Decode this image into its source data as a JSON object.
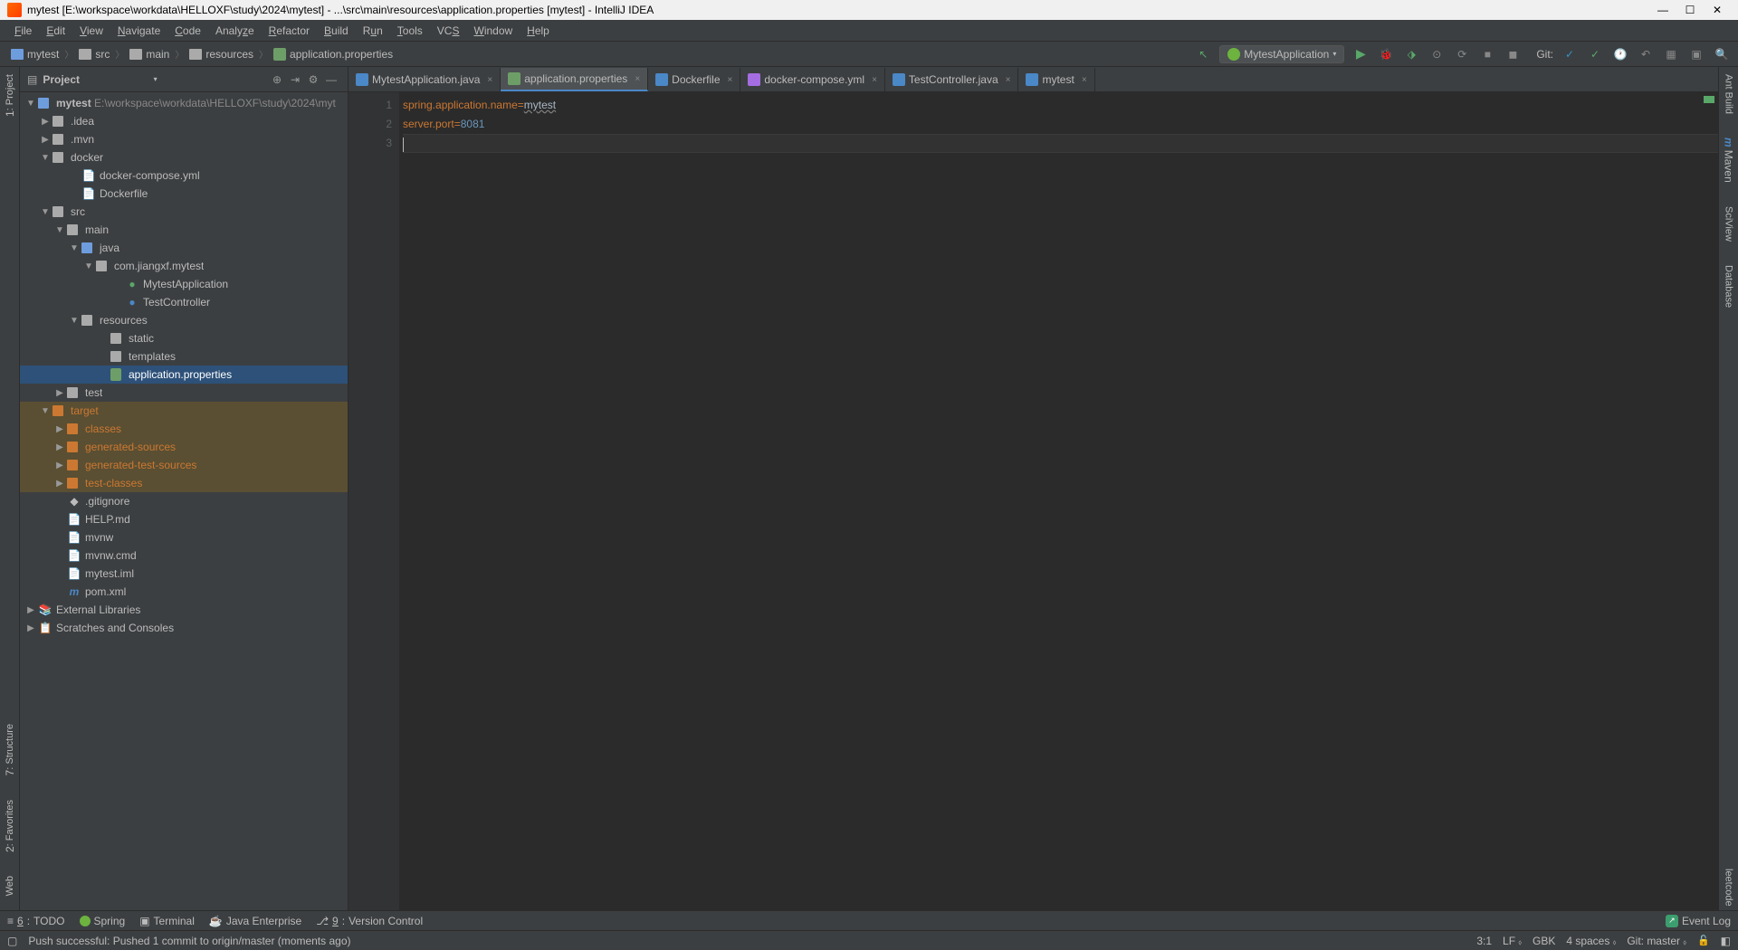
{
  "window": {
    "title": "mytest [E:\\workspace\\workdata\\HELLOXF\\study\\2024\\mytest] - ...\\src\\main\\resources\\application.properties [mytest] - IntelliJ IDEA"
  },
  "menu": [
    "File",
    "Edit",
    "View",
    "Navigate",
    "Code",
    "Analyze",
    "Refactor",
    "Build",
    "Run",
    "Tools",
    "VCS",
    "Window",
    "Help"
  ],
  "breadcrumbs": [
    "mytest",
    "src",
    "main",
    "resources",
    "application.properties"
  ],
  "runConfig": "MytestApplication",
  "gitLabel": "Git:",
  "leftGutter": [
    "1: Project"
  ],
  "leftGutterBottom": [
    "7: Structure",
    "2: Favorites",
    "Web"
  ],
  "rightGutter": [
    "Ant Build",
    "Maven",
    "SciView",
    "Database",
    "leetcode"
  ],
  "projectPanel": {
    "title": "Project"
  },
  "tree": {
    "root": {
      "name": "mytest",
      "path": "E:\\workspace\\workdata\\HELLOXF\\study\\2024\\myt"
    },
    "idea": ".idea",
    "mvn": ".mvn",
    "docker": "docker",
    "dockerCompose": "docker-compose.yml",
    "dockerfile": "Dockerfile",
    "src": "src",
    "main": "main",
    "java": "java",
    "pkg": "com.jiangxf.mytest",
    "mytestApp": "MytestApplication",
    "testCtrl": "TestController",
    "resources": "resources",
    "static": "static",
    "templates": "templates",
    "appProps": "application.properties",
    "test": "test",
    "target": "target",
    "classes": "classes",
    "genSrc": "generated-sources",
    "genTestSrc": "generated-test-sources",
    "testClasses": "test-classes",
    "gitignore": ".gitignore",
    "help": "HELP.md",
    "mvnw": "mvnw",
    "mvnwCmd": "mvnw.cmd",
    "iml": "mytest.iml",
    "pom": "pom.xml",
    "extLib": "External Libraries",
    "scratches": "Scratches and Consoles"
  },
  "editorTabs": [
    {
      "name": "MytestApplication.java",
      "type": "java",
      "active": false
    },
    {
      "name": "application.properties",
      "type": "prop",
      "active": true
    },
    {
      "name": "Dockerfile",
      "type": "docker",
      "active": false
    },
    {
      "name": "docker-compose.yml",
      "type": "yml",
      "active": false
    },
    {
      "name": "TestController.java",
      "type": "java",
      "active": false
    },
    {
      "name": "mytest",
      "type": "m",
      "active": false
    }
  ],
  "code": {
    "line1_key": "spring.application.name",
    "line1_op": "=",
    "line1_val": "mytest",
    "line2_key": "server.port",
    "line2_op": "=",
    "line2_val": "8081",
    "gutter": [
      "1",
      "2",
      "3"
    ]
  },
  "bottomTools": {
    "todo": "6: TODO",
    "spring": "Spring",
    "terminal": "Terminal",
    "javaEE": "Java Enterprise",
    "vcs": "9: Version Control",
    "eventLog": "Event Log"
  },
  "statusBar": {
    "msg": "Push successful: Pushed 1 commit to origin/master (moments ago)",
    "pos": "3:1",
    "le": "LF",
    "enc": "GBK",
    "indent": "4 spaces",
    "branch": "Git: master"
  }
}
